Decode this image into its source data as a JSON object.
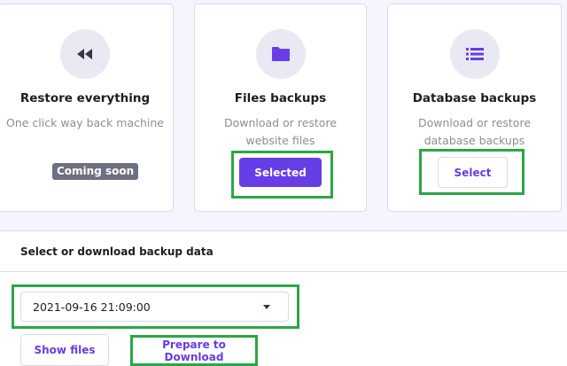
{
  "cards": [
    {
      "icon": "rewind-icon",
      "title": "Restore everything",
      "description": "One click way back machine",
      "badge": "Coming soon"
    },
    {
      "icon": "folder-icon",
      "title": "Files backups",
      "description": "Download or restore website files",
      "button_label": "Selected"
    },
    {
      "icon": "list-icon",
      "title": "Database backups",
      "description": "Download or restore database backups",
      "button_label": "Select"
    }
  ],
  "download_panel": {
    "header": "Select or download backup data",
    "selected_backup": "2021-09-16 21:09:00",
    "show_files_label": "Show files",
    "prepare_label": "Prepare to Download"
  },
  "colors": {
    "accent": "#673de6",
    "highlight": "#2aa745",
    "badge": "#6d7081",
    "page_background": "#f4f5ff"
  }
}
